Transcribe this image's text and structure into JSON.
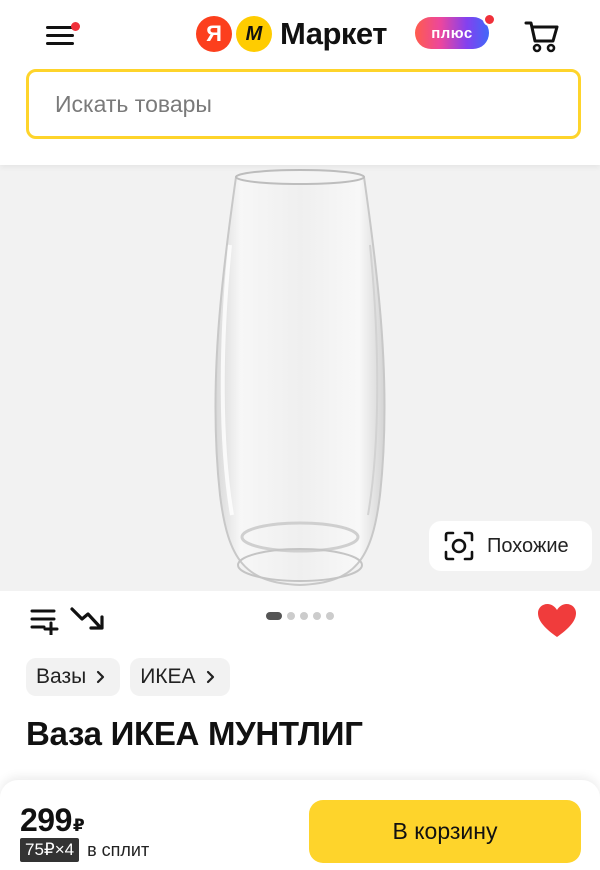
{
  "header": {
    "logo_ya": "Я",
    "logo_m": "М",
    "logo_text": "Маркет",
    "plus_label": "плюс",
    "menu_icon": "hamburger-icon",
    "cart_icon": "cart-icon"
  },
  "search": {
    "placeholder": "Искать товары",
    "value": ""
  },
  "gallery": {
    "similar_label": "Похожие",
    "similar_icon": "camera-scan-icon",
    "slide_count": 5,
    "active_slide": 1
  },
  "tools": {
    "compare_icon": "list-add-icon",
    "price_trend_icon": "trend-down-icon",
    "favorite_icon": "heart-icon"
  },
  "breadcrumbs": [
    {
      "label": "Вазы"
    },
    {
      "label": "ИКЕА"
    }
  ],
  "product": {
    "title": "Ваза ИКЕА МУНТЛИГ"
  },
  "purchase": {
    "price": "299",
    "currency": "₽",
    "split_badge": "75₽×4",
    "split_text": "в сплит",
    "button_label": "В корзину"
  },
  "colors": {
    "accent_yellow": "#fed42b",
    "logo_red": "#fc3f1d",
    "heart_red": "#f03c3c"
  }
}
